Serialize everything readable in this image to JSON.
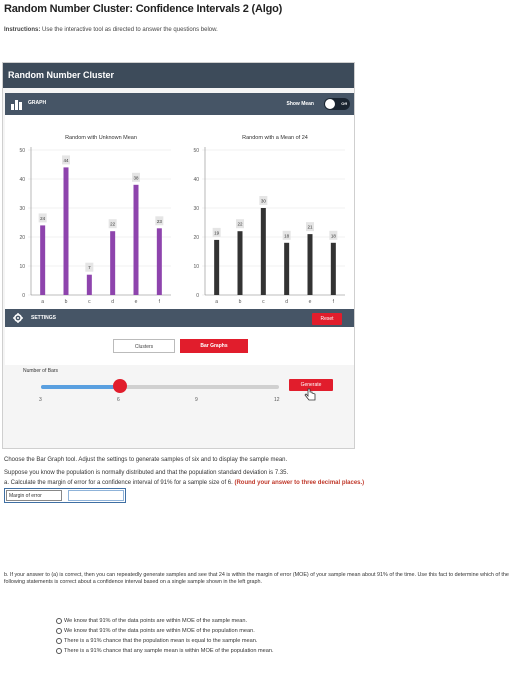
{
  "page": {
    "title": "Random Number Cluster: Confidence Intervals 2 (Algo)",
    "instructions_label": "Instructions:",
    "instructions_text": "Use the interactive tool as directed to answer the questions below."
  },
  "widget": {
    "header": "Random Number Cluster",
    "graph_label": "GRAPH",
    "show_mean_label": "Show Mean",
    "toggle_state": "Off",
    "settings_label": "SETTINGS",
    "reset_label": "Reset",
    "tabs": {
      "clusters": "Clusters",
      "bar_graphs": "Bar Graphs"
    },
    "number_of_bars_label": "Number of Bars",
    "slider": {
      "min": 3,
      "max": 12,
      "value": 6,
      "ticks": [
        "3",
        "6",
        "9",
        "12"
      ]
    },
    "generate_label": "Generate",
    "colors": {
      "header": "#3d4b5a",
      "accent": "#e11d2c",
      "bar_left": "#8e44ad",
      "bar_right": "#333333"
    }
  },
  "chart_data": [
    {
      "type": "bar",
      "title": "Random with Unknown Mean",
      "categories": [
        "a",
        "b",
        "c",
        "d",
        "e",
        "f"
      ],
      "values": [
        24,
        44,
        7,
        22,
        38,
        23
      ],
      "ylim": [
        0,
        50
      ],
      "yticks": [
        "0",
        "10",
        "20",
        "30",
        "40",
        "50"
      ]
    },
    {
      "type": "bar",
      "title": "Random with a Mean of 24",
      "categories": [
        "a",
        "b",
        "c",
        "d",
        "e",
        "f"
      ],
      "values": [
        19,
        22,
        30,
        18,
        21,
        18
      ],
      "ylim": [
        0,
        50
      ],
      "yticks": [
        "0",
        "10",
        "20",
        "30",
        "40",
        "50"
      ]
    }
  ],
  "questions": {
    "line1": "Choose the Bar Graph tool. Adjust the settings to generate samples of six and to display the sample mean.",
    "line2": "Suppose you know the population is normally distributed and that the population standard deviation is 7.35.",
    "a_text": "a. Calculate the margin of error for a confidence interval of 91% for a sample size of 6.",
    "a_note": "(Round your answer to three decimal places.)",
    "moe_label": "Margin of error",
    "moe_value": "",
    "b_text": "b. If your answer to (a) is correct, then you can repeatedly generate samples and see that 24 is within the margin of error (MOE) of your sample mean about 91% of the time. Use this fact to determine which of the following statements is correct about a confidence interval based on a single sample shown in the left graph.",
    "options": [
      "We know that 91% of the data points are within MOE of the sample mean.",
      "We know that 91% of the data points are within MOE of the population mean.",
      "There is a 91% chance that the population mean is equal to the sample mean.",
      "There is a 91% chance that any sample mean is within MOE of the population mean."
    ]
  }
}
